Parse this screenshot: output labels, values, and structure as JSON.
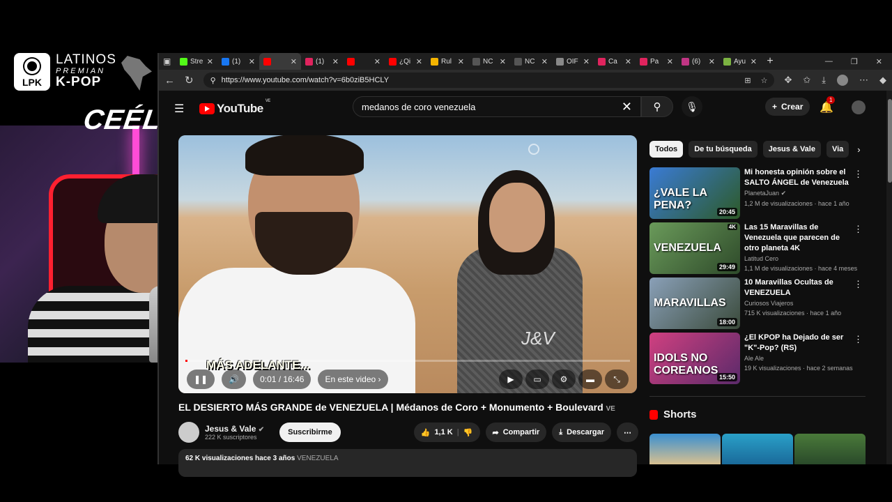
{
  "overlay": {
    "logo_badge": "LPK",
    "logo_line1": "LATINOS",
    "logo_line2": "PREMIAN",
    "logo_line3": "K-POP",
    "streamer_name": "CEÉLE"
  },
  "browser": {
    "tabs": [
      {
        "label": "Stre",
        "color": "#53fc18"
      },
      {
        "label": "(1)",
        "color": "#1877f2"
      },
      {
        "label": "",
        "color": "#ff0000",
        "active": true
      },
      {
        "label": "(1)",
        "color": "#e0245e"
      },
      {
        "label": "",
        "color": "#ff0000"
      },
      {
        "label": "¿Qi",
        "color": "#ff0000"
      },
      {
        "label": "Rul",
        "color": "#f4b400"
      },
      {
        "label": "NC",
        "color": "#555555"
      },
      {
        "label": "NC",
        "color": "#555555"
      },
      {
        "label": "OIF",
        "color": "#888888"
      },
      {
        "label": "Ca",
        "color": "#e0245e"
      },
      {
        "label": "Pa",
        "color": "#e0245e"
      },
      {
        "label": "(6)",
        "color": "#c13584"
      },
      {
        "label": "Ayu",
        "color": "#7cb342"
      }
    ],
    "url": "https://www.youtube.com/watch?v=6b0ziB5HCLY"
  },
  "youtube": {
    "logo_text": "YouTube",
    "country_code": "VE",
    "search_query": "medanos de coro venezuela",
    "create_label": "Crear",
    "notification_count": "1",
    "player": {
      "caption": "MÁS ADELANTE...",
      "time": "0:01 / 16:46",
      "chapter_label": "En este video",
      "progress": 0.001
    },
    "video": {
      "title": "EL DESIERTO MÁS GRANDE de VENEZUELA | Médanos de Coro + Monumento + Boulevard",
      "title_suffix": "VE",
      "channel_name": "Jesus & Vale",
      "subscribers": "222 K suscriptores",
      "subscribe_label": "Suscribirme",
      "likes": "1,1 K",
      "share_label": "Compartir",
      "download_label": "Descargar",
      "views_date": "62 K visualizaciones  hace 3 años",
      "hashtag": "VENEZUELA"
    },
    "chips": [
      "Todos",
      "De tu búsqueda",
      "Jesus & Vale",
      "Via"
    ],
    "recommendations": [
      {
        "title": "Mi honesta opinión sobre el SALTO ÁNGEL de Venezuela",
        "channel": "PlanetaJuan",
        "verified": true,
        "meta": "1,2 M de visualizaciones · hace 1 año",
        "duration": "20:45",
        "thumb_text": "¿VALE LA PENA?",
        "color1": "#3a7bd5",
        "color2": "#2d5a27"
      },
      {
        "title": "Las 15 Maravillas de Venezuela que parecen de otro planeta 4K",
        "channel": "Latitud Cero",
        "verified": false,
        "meta": "1,1 M de visualizaciones · hace 4 meses",
        "duration": "29:49",
        "quality": "4K",
        "thumb_text": "VENEZUELA",
        "color1": "#6a9a5a",
        "color2": "#2e4a2a"
      },
      {
        "title": "10 Maravillas Ocultas de VENEZUELA",
        "channel": "Curiosos Viajeros",
        "verified": false,
        "meta": "715 K visualizaciones · hace 1 año",
        "duration": "18:00",
        "thumb_text": "MARAVILLAS",
        "color1": "#8aa0b8",
        "color2": "#3a4a3a"
      },
      {
        "title": "¿El KPOP ha Dejado de ser \"K\"-Pop? (RS)",
        "channel": "Ale Ale",
        "verified": false,
        "meta": "19 K visualizaciones · hace 2 semanas",
        "duration": "15:50",
        "thumb_text": "IDOLS NO COREANOS",
        "color1": "#d04080",
        "color2": "#5a2a6a"
      }
    ],
    "shorts_label": "Shorts"
  }
}
